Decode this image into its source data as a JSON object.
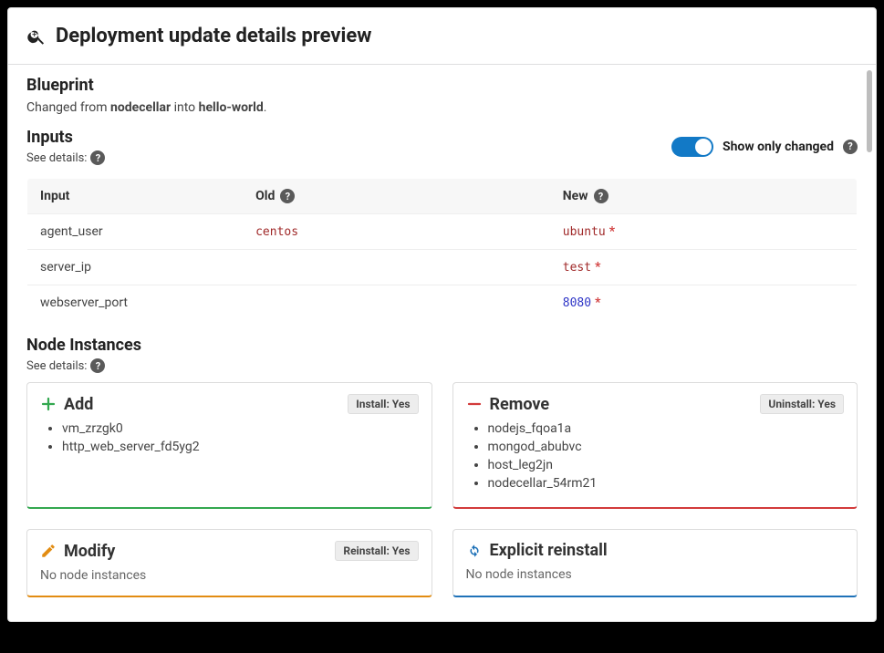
{
  "header": {
    "title": "Deployment update details preview"
  },
  "blueprint": {
    "heading": "Blueprint",
    "prefix": "Changed from ",
    "from": "nodecellar",
    "middle": " into ",
    "to": "hello-world",
    "suffix": "."
  },
  "inputs": {
    "heading": "Inputs",
    "see_details": "See details:",
    "toggle_label": "Show only changed",
    "columns": {
      "input": "Input",
      "old": "Old",
      "new": "New"
    },
    "rows": [
      {
        "name": "agent_user",
        "old": "centos",
        "old_type": "str",
        "new": "ubuntu",
        "new_type": "str",
        "new_changed": true
      },
      {
        "name": "server_ip",
        "old": "",
        "old_type": "",
        "new": "test",
        "new_type": "str",
        "new_changed": true
      },
      {
        "name": "webserver_port",
        "old": "",
        "old_type": "",
        "new": "8080",
        "new_type": "num",
        "new_changed": true
      }
    ]
  },
  "node_instances": {
    "heading": "Node Instances",
    "see_details": "See details:",
    "empty_text": "No node instances",
    "cards": {
      "add": {
        "title": "Add",
        "badge": "Install: Yes",
        "items": [
          "vm_zrzgk0",
          "http_web_server_fd5yg2"
        ]
      },
      "remove": {
        "title": "Remove",
        "badge": "Uninstall: Yes",
        "items": [
          "nodejs_fqoa1a",
          "mongod_abubvc",
          "host_leg2jn",
          "nodecellar_54rm21"
        ]
      },
      "modify": {
        "title": "Modify",
        "badge": "Reinstall: Yes",
        "items": []
      },
      "explicit": {
        "title": "Explicit reinstall",
        "badge": "",
        "items": []
      }
    }
  }
}
